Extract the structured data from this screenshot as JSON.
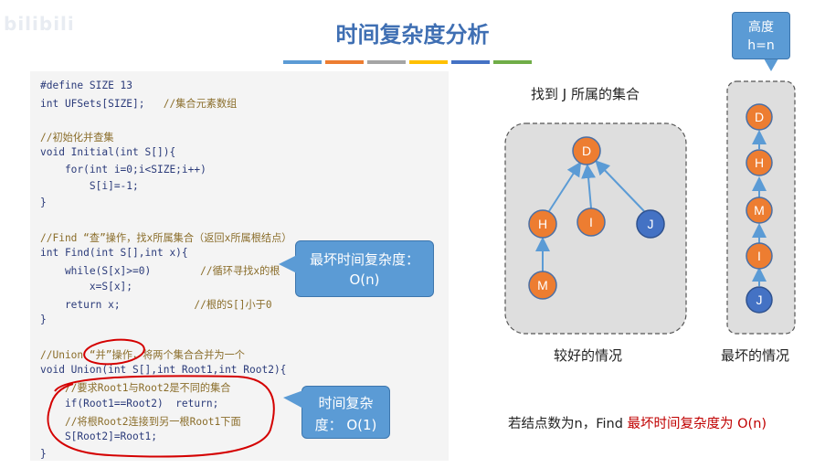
{
  "watermark": "bilibili",
  "title": "时间复杂度分析",
  "colorbar": [
    "#5b9bd5",
    "#ed7d31",
    "#a5a5a5",
    "#ffc000",
    "#4472c4",
    "#70ad47"
  ],
  "code": [
    {
      "code": "#define SIZE 13",
      "comment": ""
    },
    {
      "code": "int UFSets[SIZE];   ",
      "comment": "//集合元素数组"
    },
    {
      "code": "",
      "comment": ""
    },
    {
      "code": "",
      "comment": "//初始化并查集"
    },
    {
      "code": "void Initial(int S[]){",
      "comment": ""
    },
    {
      "code": "    for(int i=0;i<SIZE;i++)",
      "comment": ""
    },
    {
      "code": "        S[i]=-1;",
      "comment": ""
    },
    {
      "code": "}",
      "comment": ""
    },
    {
      "code": "",
      "comment": ""
    },
    {
      "code": "",
      "comment": "//Find “查”操作，找x所属集合（返回x所属根结点）"
    },
    {
      "code": "int Find(int S[],int x){",
      "comment": ""
    },
    {
      "code": "    while(S[x]>=0)        ",
      "comment": "//循环寻找x的根"
    },
    {
      "code": "        x=S[x];",
      "comment": ""
    },
    {
      "code": "    return x;            ",
      "comment": "//根的S[]小于0"
    },
    {
      "code": "}",
      "comment": ""
    },
    {
      "code": "",
      "comment": ""
    },
    {
      "code": "",
      "comment": "//Union “并”操作，将两个集合合并为一个"
    },
    {
      "code": "void Union(int S[],int Root1,int Root2){",
      "comment": ""
    },
    {
      "code": "    ",
      "comment": "//要求Root1与Root2是不同的集合"
    },
    {
      "code": "    if(Root1==Root2)  return;",
      "comment": ""
    },
    {
      "code": "    ",
      "comment": "//将根Root2连接到另一根Root1下面"
    },
    {
      "code": "    S[Root2]=Root1;",
      "comment": ""
    },
    {
      "code": "}",
      "comment": ""
    }
  ],
  "bubble_find": {
    "line1": "最坏时间复杂度：",
    "line2": "O(n)"
  },
  "bubble_union": {
    "line1": "时间复杂",
    "line2": "度： O(1)"
  },
  "graph_left": {
    "heading": "找到 J 所属的集合",
    "caption": "较好的情况",
    "nodes": [
      "D",
      "H",
      "I",
      "J",
      "M"
    ]
  },
  "graph_right": {
    "caption": "最坏的情况",
    "nodes": [
      "D",
      "H",
      "M",
      "I",
      "J"
    ]
  },
  "height_label": {
    "line1": "高度",
    "line2": "h=n"
  },
  "footer": {
    "prefix": "若结点数为n，Find ",
    "highlight": "最坏时间复杂度为 O(n)"
  },
  "colors": {
    "node_orange": "#ed7d31",
    "node_blue": "#4472c4",
    "edge": "#5b9bd5",
    "accent_red": "#c00000"
  }
}
